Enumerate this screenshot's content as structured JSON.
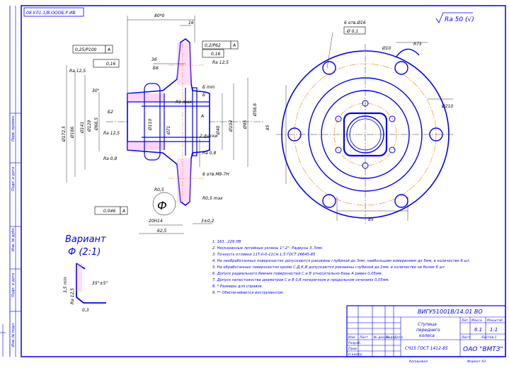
{
  "sheet": {
    "stamp_code": "08 УЛ1.1/В.ОООБ.Р.ИВ",
    "roughness": "Ra 50 (√)",
    "designation": "ВИГУ51001В/14.01 ВО",
    "part_title": [
      "Ступица",
      "переднего",
      "колеса"
    ],
    "material": "СЧ15 ГОСТ 1412-85",
    "company": "ОАО \"ВМТЗ\"",
    "scale": "1:1",
    "mass": "6.1",
    "variant_title": "Вариант",
    "variant_scale": "Ф (2:1)",
    "view_letter": "Ф",
    "format_note": "Формат А3"
  },
  "dimensions": {
    "top_width": "80*0",
    "d36": "36",
    "d16": "16",
    "ra125a": "Ra 12,5",
    "ra125b": "Ra 12,5",
    "ra125c": "Ra 12,5",
    "ra08a": "Ra 0,8",
    "ra08b": "Ra 0,8",
    "tol1": "0,25/Р100",
    "tol1_ref": "А",
    "tol2": "0,16",
    "tol3": "0,2/Р62",
    "tol3_ref": "А",
    "tol4": "0,16",
    "tol5": "0,046",
    "tol5_ref": "А",
    "angle30": "30°",
    "b62": "Б2",
    "b6": "Б6",
    "b6min": "Б min",
    "b_letter": "Б",
    "a_letter": "А",
    "r05": "R0,5",
    "r05max": "R0,5 max",
    "r1max": "R1 max",
    "d20": "20H14",
    "d625": "62,5",
    "d3": "3±0,2",
    "holes": "6 отв.М8-7Н",
    "holes_top": "6 отв.Ø16",
    "holes_top_tol": "Ø 0,1",
    "d85a": "85",
    "d85b": "85",
    "d210": "Ø210",
    "r75": "R75",
    "d10": "Ø10",
    "facet": "2 фаски",
    "dia_left1": "Ø172,5",
    "dia_left2": "Ø186",
    "dia_left3": "Ø141",
    "dia_left4": "Ø129",
    "dia_left5": "Ø68,5",
    "dia_right1": "Ø104",
    "dia_right2": "Ø95",
    "dia_right3": "Ø58,6",
    "dia_mid1": "Ø110",
    "dia_mid2": "Ø71",
    "dia_mid3": "Ø40"
  },
  "variant": {
    "a1": "3,5 min",
    "a2": "35°±5°",
    "a3": "0,3",
    "a4": "Ra 12,5"
  },
  "notes": [
    "1. 163...229 НВ",
    "2. Неуказанные литейные уклоны 1°-2°. Радиусы 3..5мм.",
    "3. Точность отливки 11Т-0-0-11См 1,5 ГОСТ 26645-85",
    "4. На необработанных поверхностях допускаются раковины глубиной до 3мм, наибольшим измерением до 5мм, в количестве 6 шт.",
    "5. На обработанных поверхностях кроме С,Д,К,И допускаются раковины глубиной до 2мм, в количестве не более 6 шт.",
    "6. Допуск радиального биения поверхностей С и В относительно базы А равен 0,05мм.",
    "7. Допуск непостоянства диаметров С и В 0,8 поперечном и продольном сечениях 0,05мм.",
    "8. * Размеры для справок.",
    "9. ** Обеспечивается инструментом."
  ],
  "title_block": {
    "rows": [
      "Изм",
      "Лист",
      "№ докум.",
      "Подп.",
      "Дата"
    ],
    "roles": [
      "Разраб.",
      "Пров.",
      "Т.контр.",
      "Н.контр.",
      "Утв."
    ],
    "lit": "Лит.",
    "mass_label": "Масса",
    "scale_label": "Масштаб",
    "sheet_label": "Лист",
    "sheets_label": "Листов 1",
    "copy": "Копировал"
  },
  "side_labels": [
    "Перв. примен.",
    "Справ. №",
    "Подп. и дата",
    "Инв. № дубл.",
    "Взам. инв. №",
    "Подп. и дата",
    "Инв. № подл."
  ]
}
